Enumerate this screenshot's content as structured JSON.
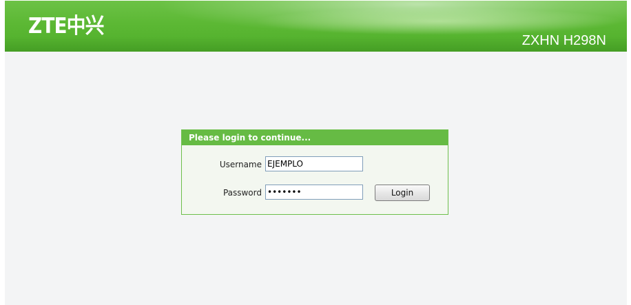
{
  "header": {
    "logo_text": "ZTE中兴",
    "model": "ZXHN H298N"
  },
  "login": {
    "title": "Please login to continue...",
    "username_label": "Username",
    "username_value": "EJEMPLO",
    "password_label": "Password",
    "password_value": "•••••••",
    "login_button": "Login"
  },
  "colors": {
    "brand_green": "#5cb834",
    "panel_header": "#66bb44",
    "background": "#f3f4f5"
  }
}
